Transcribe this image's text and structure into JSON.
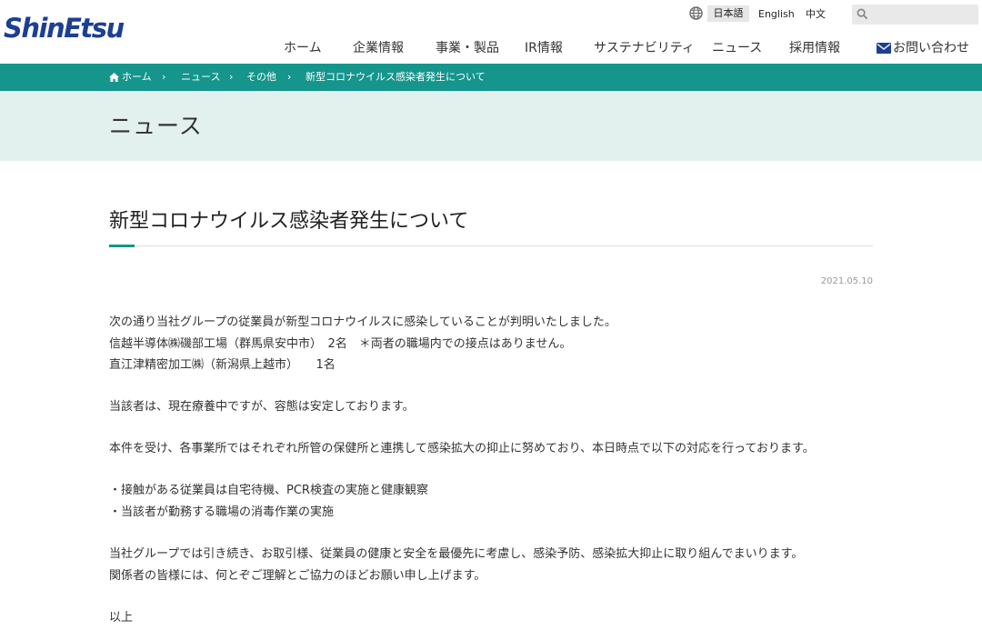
{
  "header": {
    "logo_text": "ShinEtsu",
    "languages": {
      "ja": "日本語",
      "en": "English",
      "zh": "中文"
    },
    "search": {
      "placeholder": ""
    }
  },
  "nav": {
    "items": [
      "ホーム",
      "企業情報",
      "事業・製品",
      "IR情報",
      "サステナビリティ",
      "ニュース",
      "採用情報"
    ],
    "contact": "お問い合わせ"
  },
  "breadcrumb": [
    "ホーム",
    "ニュース",
    "その他",
    "新型コロナウイルス感染者発生について"
  ],
  "page_header": {
    "title": "ニュース"
  },
  "article": {
    "title": "新型コロナウイルス感染者発生について",
    "date": "2021.05.10",
    "paragraphs": [
      [
        "次の通り当社グループの従業員が新型コロナウイルスに感染していることが判明いたしました。",
        "信越半導体㈱磯部工場（群馬県安中市）　2名　＊両者の職場内での接点はありません。",
        "直江津精密加工㈱（新潟県上越市）　　1名"
      ],
      [
        "当該者は、現在療養中ですが、容態は安定しております。"
      ],
      [
        "本件を受け、各事業所ではそれぞれ所管の保健所と連携して感染拡大の抑止に努めており、本日時点で以下の対応を行っております。"
      ],
      [
        "・接触がある従業員は自宅待機、PCR検査の実施と健康観察",
        "・当該者が勤務する職場の消毒作業の実施"
      ],
      [
        "当社グループでは引き続き、お取引様、従業員の健康と安全を最優先に考慮し、感染予防、感染拡大抑止に取り組んでまいります。",
        "関係者の皆様には、何とぞご理解とご協力のほどお願い申し上げます。"
      ],
      [
        "以上"
      ]
    ]
  },
  "colors": {
    "brand_blue": "#1c3f94",
    "teal": "#15958c",
    "band": "#e3f1ee"
  },
  "icons": [
    "globe-icon",
    "search-icon",
    "mail-icon",
    "home-icon",
    "chevron-right-icon"
  ]
}
